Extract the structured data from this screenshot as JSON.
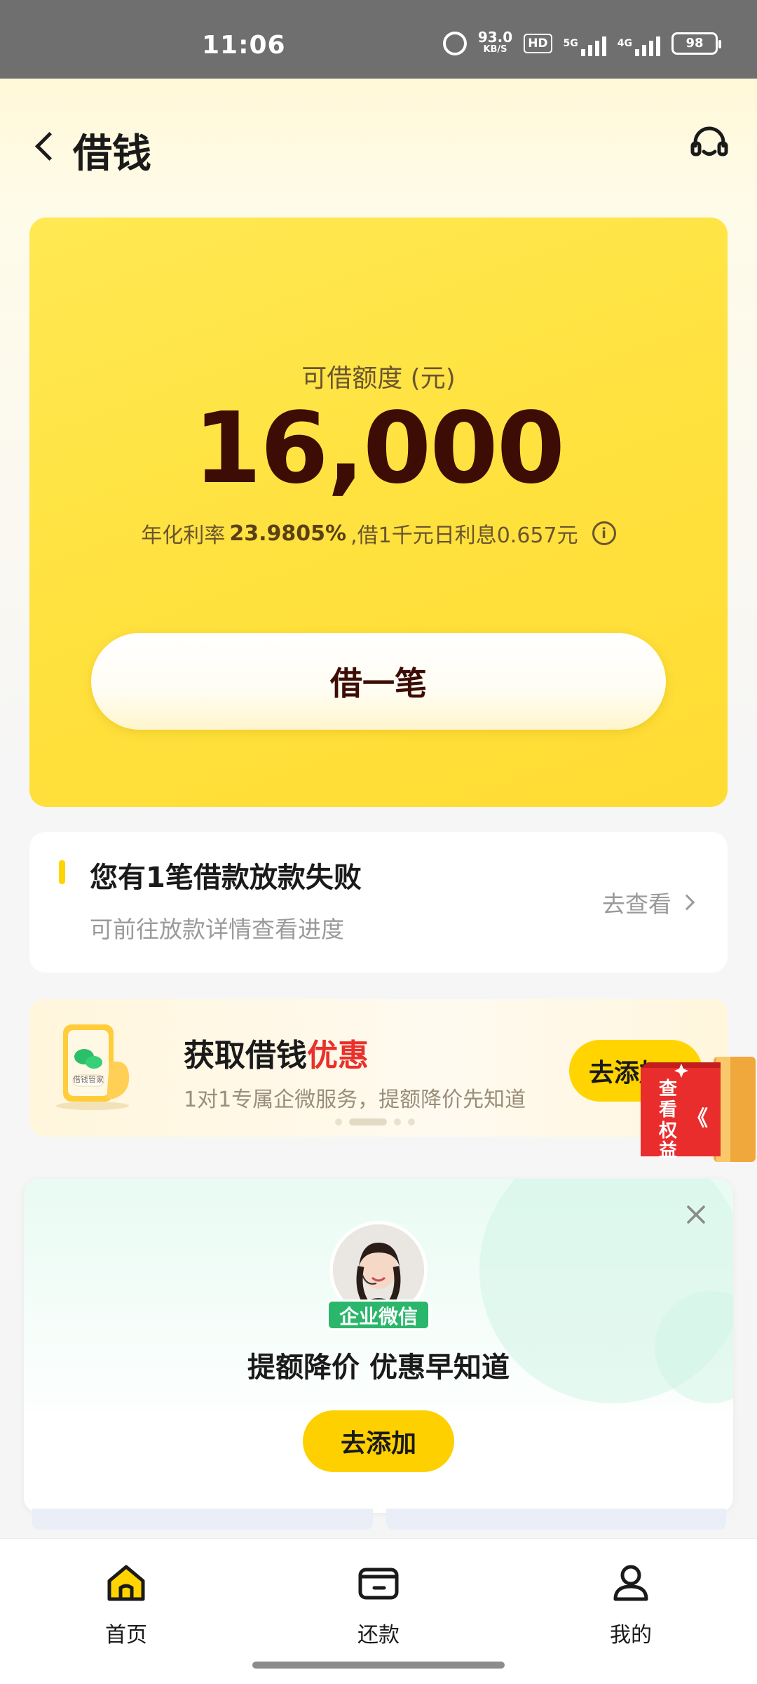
{
  "status_bar": {
    "time": "11:06",
    "speed_value": "93.0",
    "speed_unit": "KB/S",
    "hd": "HD",
    "net1": "5G",
    "net2": "4G",
    "battery": "98"
  },
  "header": {
    "title": "借钱",
    "icons": [
      "back-icon",
      "customer-service-icon"
    ]
  },
  "loan_card": {
    "limit_label": "可借额度 (元)",
    "limit_amount": "16,000",
    "rate_prefix": "年化利率",
    "rate_value": "23.9805%",
    "rate_suffix": ",借1千元日利息0.657元",
    "borrow_button": "借一笔"
  },
  "notice": {
    "title": "您有1笔借款放款失败",
    "subtitle": "可前往放款详情查看进度",
    "link": "去查看"
  },
  "promo": {
    "title_plain": "获取借钱",
    "title_highlight": "优惠",
    "subtitle": "1对1专属企微服务，提额降价先知道",
    "phone_label": "借钱管家",
    "button": "去添加",
    "carousel_active_index": 1
  },
  "float_badge": {
    "text": "查看权益",
    "arrow": "《"
  },
  "wechat_card": {
    "badge": "企业微信",
    "title": "提额降价 优惠早知道",
    "button": "去添加"
  },
  "bottom_nav": {
    "items": [
      {
        "label": "首页",
        "icon": "home-icon",
        "active": true
      },
      {
        "label": "还款",
        "icon": "wallet-icon",
        "active": false
      },
      {
        "label": "我的",
        "icon": "profile-icon",
        "active": false
      }
    ]
  },
  "colors": {
    "brand_yellow": "#ffe13d",
    "button_yellow": "#ffd400",
    "amount_text": "#3d0d05",
    "highlight_red": "#e9302a",
    "wework_green": "#2ab66b"
  }
}
